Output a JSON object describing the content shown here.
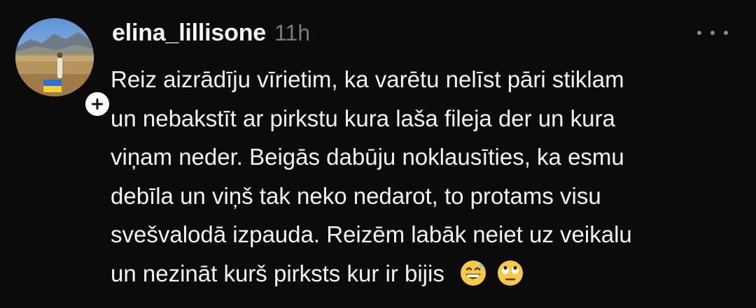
{
  "post": {
    "username": "elina_lillisone",
    "timestamp": "11h",
    "avatar_badge": "ukraine-flag",
    "follow_label": "+",
    "lines": [
      "Reiz aizrādīju vīrietim, ka varētu nelīst pāri stiklam",
      "un nebakstīt ar pirkstu kura laša fileja der un kura",
      "viņam neder. Beigās dabūju noklausīties, ka esmu",
      "debīla un viņš tak neko nedarot, to protams visu",
      "svešvalodā izpauda.  Reizēm labāk neiet uz veikalu",
      "un nezināt kurš pirksts kur ir bijis"
    ],
    "emojis": [
      "grinning-sweat-emoji",
      "eye-roll-emoji"
    ]
  },
  "colors": {
    "background": "#0b0b0b",
    "text": "#f3f3f3",
    "muted": "#7a7a7a",
    "emoji_yellow": "#f7c948"
  }
}
